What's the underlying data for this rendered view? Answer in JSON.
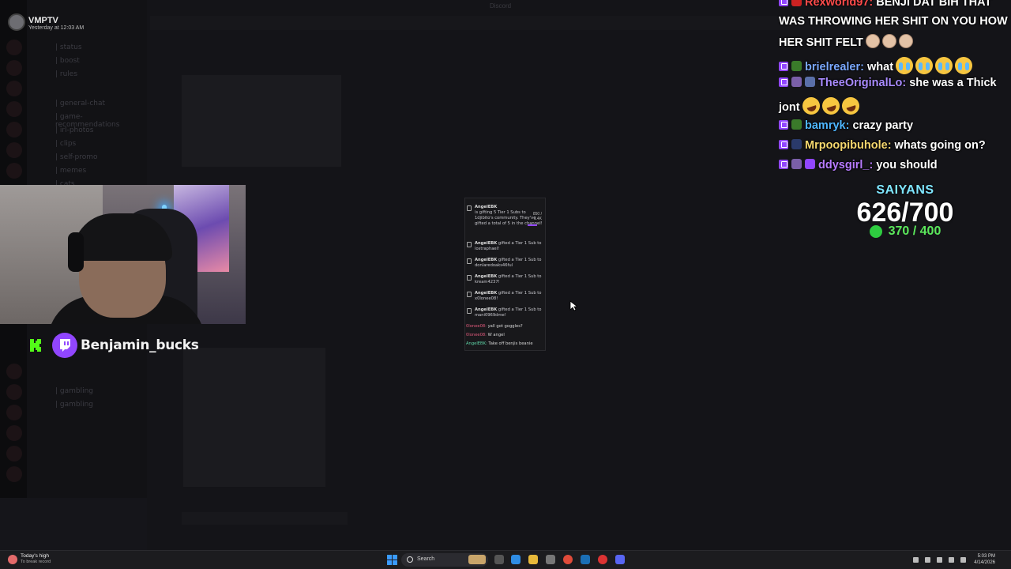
{
  "discord": {
    "profile_name": "VMPTV",
    "profile_time": "Yesterday at 12:03 AM",
    "window_title": "Discord",
    "channels": [
      "| status",
      "| boost",
      "| rules",
      "| general-chat",
      "| game-recommendations",
      "| irl-photos",
      "| clips",
      "| self-promo",
      "| memes",
      "| cats",
      "| gambling",
      "| gambling"
    ]
  },
  "webcam": {
    "streamer_name": "Benjamin_bucks"
  },
  "popup": {
    "gift_header": {
      "name": "AngelEBK",
      "text": "is gifting 5 Tier 1 Subs to 1djibito's community. They've gifted a total of 5 in the channel!"
    },
    "progress_text": "850 / 1.4K",
    "gifts": [
      {
        "name": "AngelEBK",
        "text": "gifted a Tier 1 Sub to lostraphael!"
      },
      {
        "name": "AngelEBK",
        "text": "gifted a Tier 1 Sub to donlaredoaks46ful"
      },
      {
        "name": "AngelEBK",
        "text": "gifted a Tier 1 Sub to kream4237!"
      },
      {
        "name": "AngelEBK",
        "text": "gifted a Tier 1 Sub to x0lonee08!"
      },
      {
        "name": "AngelEBK",
        "text": "gifted a Tier 1 Sub to mani0969dme!"
      }
    ],
    "chat": [
      {
        "name": "0lonee08:",
        "text": " yall got goggles?",
        "color": "#e05a7c"
      },
      {
        "name": "0lonee08:",
        "text": " W angel",
        "color": "#e05a7c"
      },
      {
        "name": "AngelEBK:",
        "text": " Take off benjis beanie",
        "color": "#5fd6a8"
      }
    ]
  },
  "chat_overlay": {
    "messages": [
      {
        "name": "Rexworld97:",
        "name_color": "#ff4b4b",
        "text": " BENJI DAT BIH THAT"
      },
      {
        "name": "",
        "name_color": "#ffffff",
        "text": "WAS THROWING HER SHIT ON YOU HOW"
      },
      {
        "name": "",
        "name_color": "#ffffff",
        "text": "HER SHIT FELT"
      },
      {
        "name": "brielrealer:",
        "name_color": "#7aa8ff",
        "text": " what"
      },
      {
        "name": "TheeOriginalLo:",
        "name_color": "#a98bff",
        "text": " she was a Thick"
      },
      {
        "name": "",
        "name_color": "#ffffff",
        "text": "jont"
      },
      {
        "name": "bamryk:",
        "name_color": "#4fb7ff",
        "text": " crazy party"
      },
      {
        "name": "Mrpoopibuhole:",
        "name_color": "#f5d76e",
        "text": " whats going on?"
      },
      {
        "name": "ddysgirl_:",
        "name_color": "#b77bff",
        "text": " you should"
      }
    ]
  },
  "goal": {
    "label": "SAIYANS",
    "main": "626/700",
    "sub": "370 / 400",
    "accent": "#7fe6ff",
    "sub_color": "#5be85b"
  },
  "taskbar": {
    "weather_title": "Today's high",
    "weather_sub": "To break record",
    "search_label": "Search",
    "time": "5:03 PM",
    "date": "4/14/2026"
  }
}
